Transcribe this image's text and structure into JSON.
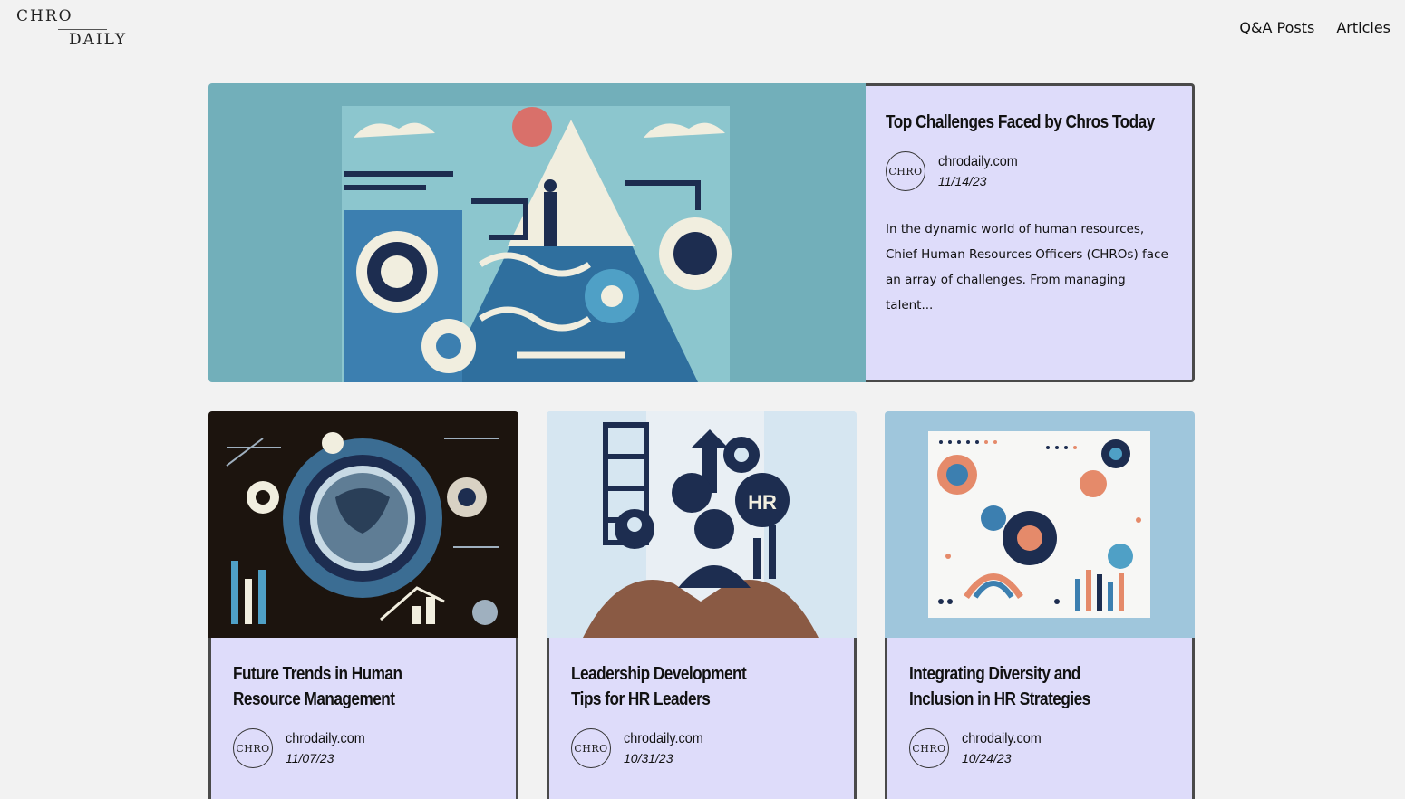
{
  "header": {
    "logo_line1": "CHRO",
    "logo_line2": "DAILY",
    "nav": [
      "Q&A Posts",
      "Articles"
    ]
  },
  "featured": {
    "title": "Top Challenges Faced by Chros Today",
    "avatar_text": "CHRO",
    "site": "chrodaily.com",
    "date": "11/14/23",
    "excerpt": "In the dynamic world of human resources, Chief Human Resources Officers (CHROs) face an array of challenges. From managing talent...",
    "image_bg": "#72afba"
  },
  "cards": [
    {
      "title": "Future Trends in Human Resource Management",
      "avatar_text": "CHRO",
      "site": "chrodaily.com",
      "date": "11/07/23",
      "image_bg": "#1c140e"
    },
    {
      "title": "Leadership Development Tips for HR Leaders",
      "avatar_text": "CHRO",
      "site": "chrodaily.com",
      "date": "10/31/23",
      "image_bg": "#cfe3ef"
    },
    {
      "title": "Integrating Diversity and Inclusion in HR Strategies",
      "avatar_text": "CHRO",
      "site": "chrodaily.com",
      "date": "10/24/23",
      "image_bg": "#9fc6dc"
    }
  ],
  "colors": {
    "panel": "#dedcfa",
    "page": "#f2f2f2",
    "border": "#4a4a4a"
  }
}
